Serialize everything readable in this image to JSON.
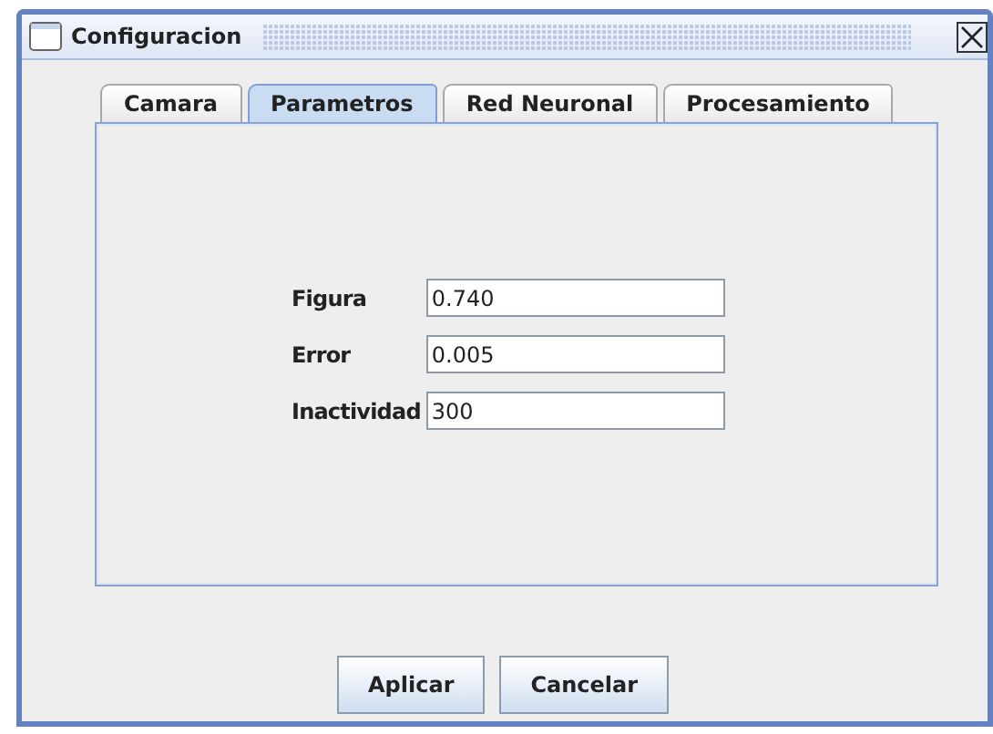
{
  "window": {
    "title": "Configuracion"
  },
  "tabs": [
    {
      "label": "Camara",
      "selected": false
    },
    {
      "label": "Parametros",
      "selected": true
    },
    {
      "label": "Red Neuronal",
      "selected": false
    },
    {
      "label": "Procesamiento",
      "selected": false
    }
  ],
  "fields": [
    {
      "label": "Figura",
      "value": "0.740"
    },
    {
      "label": "Error",
      "value": "0.005"
    },
    {
      "label": "Inactividad",
      "value": "300"
    }
  ],
  "buttons": [
    "Aplicar",
    "Cancelar"
  ]
}
